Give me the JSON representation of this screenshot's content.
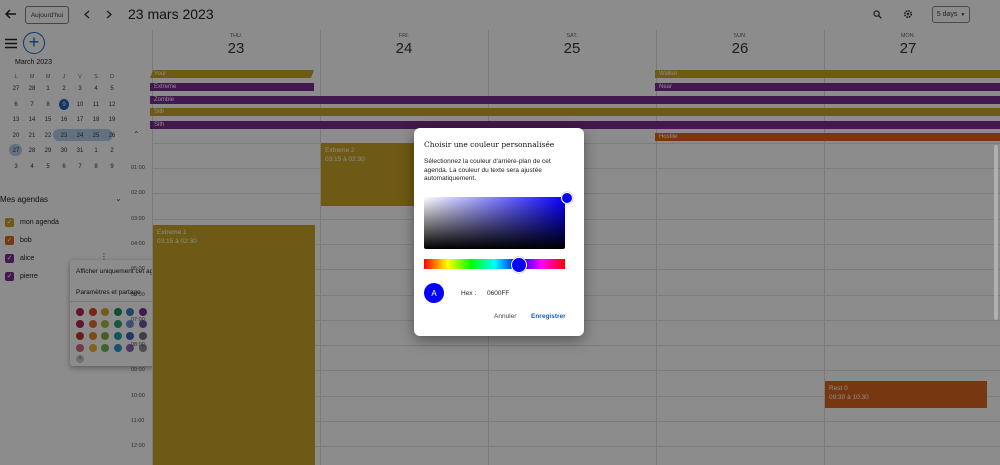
{
  "header": {
    "today_label": "Aujourd'hui",
    "date_title": "23 mars 2023",
    "view_label": "5 days",
    "icons": [
      "back-arrow-icon",
      "chevron-left-icon",
      "chevron-right-icon",
      "search-icon",
      "gear-icon",
      "dropdown-caret-icon"
    ]
  },
  "sidebar": {
    "mini_calendar": {
      "title": "March 2023",
      "weekdays": [
        "L",
        "M",
        "M",
        "J",
        "V",
        "S",
        "D"
      ],
      "weeks": [
        [
          "27",
          "28",
          "1",
          "2",
          "3",
          "4",
          "5"
        ],
        [
          "6",
          "7",
          "8",
          "9",
          "10",
          "11",
          "12"
        ],
        [
          "13",
          "14",
          "15",
          "16",
          "17",
          "18",
          "19"
        ],
        [
          "20",
          "21",
          "22",
          "23",
          "24",
          "25",
          "26"
        ],
        [
          "27",
          "28",
          "29",
          "30",
          "31",
          "1",
          "2"
        ],
        [
          "3",
          "4",
          "5",
          "6",
          "7",
          "8",
          "9"
        ]
      ],
      "today": "9"
    },
    "agendas_title": "Mes agendas",
    "calendars": [
      {
        "label": "mon agenda",
        "color": "#c9a227"
      },
      {
        "label": "bob",
        "color": "#d9661f"
      },
      {
        "label": "alice",
        "color": "#7b2d8e"
      },
      {
        "label": "pierre",
        "color": "#7b2d8e"
      }
    ]
  },
  "context_menu": {
    "item1": "Afficher uniquement cet agenda",
    "item2": "Paramètres et partage",
    "swatches": [
      [
        "#b3245a",
        "#d84a2e",
        "#d4a43a",
        "#1f8a55",
        "#3a7fc4",
        "#7b2d8e"
      ],
      [
        "#b3245a",
        "#e0702f",
        "#a8b548",
        "#2f9e6e",
        "#6e8fd6",
        "#6b5a9e"
      ],
      [
        "#c0392b",
        "#e2891f",
        "#7fb13a",
        "#1e9ba0",
        "#3f5fc0",
        "#7a6e7f"
      ],
      [
        "#d46a7a",
        "#e8b53a",
        "#68b55a",
        "#2c96c9",
        "#8a63b9",
        "#8e8e8e"
      ]
    ]
  },
  "calendar": {
    "days": [
      {
        "weekday": "THU.",
        "number": "23"
      },
      {
        "weekday": "FRI.",
        "number": "24"
      },
      {
        "weekday": "SAT.",
        "number": "25"
      },
      {
        "weekday": "SUN.",
        "number": "26"
      },
      {
        "weekday": "MON.",
        "number": "27"
      }
    ],
    "hours": [
      "01:00",
      "02:00",
      "03:00",
      "04:00",
      "05:00",
      "06:00",
      "07:00",
      "08:00",
      "09:00",
      "10:00",
      "11:00",
      "12:00"
    ],
    "allday_events": [
      {
        "label": "Your",
        "color": "#c9a227"
      },
      {
        "label": "Extreme",
        "color": "#7b2d8e"
      },
      {
        "label": "Zombie",
        "color": "#7b2d8e"
      },
      {
        "label": "Sith",
        "color": "#c9a227"
      },
      {
        "label": "Sith",
        "color": "#7b2d8e"
      },
      {
        "label": "Walker",
        "color": "#c9a227"
      },
      {
        "label": "Near",
        "color": "#7b2d8e"
      },
      {
        "label": "Hostile",
        "color": "#d9661f"
      }
    ],
    "events": [
      {
        "title": "Extreme 2",
        "time": "03:15 à 02:30",
        "color": "#c9a227"
      },
      {
        "title": "Extreme 1",
        "time": "03:15 à 02:30",
        "color": "#c9a227"
      },
      {
        "title": "Rest 0",
        "time": "09:30 à 10:30",
        "color": "#d9661f"
      }
    ]
  },
  "dialog": {
    "title": "Choisir une couleur personnalisée",
    "description": "Sélectionnez la couleur d'arrière-plan de cet agenda. La couleur du texte sera ajustée automatiquement.",
    "preview_letter": "A",
    "hex_label": "Hex :",
    "hex_value": "0600FF",
    "cancel_label": "Annuler",
    "save_label": "Enregistrer",
    "selected_color": "#0600FF"
  }
}
